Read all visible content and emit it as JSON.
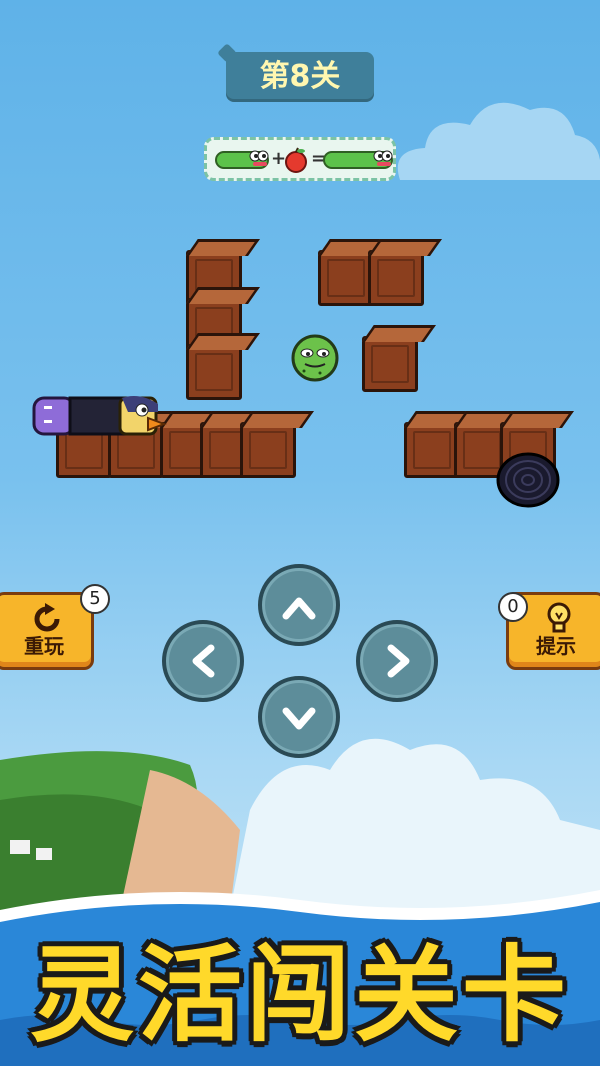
{
  "header": {
    "level_label": "第8关"
  },
  "formula": {
    "plus": "+",
    "equals": "="
  },
  "controls": {
    "restart": {
      "label": "重玩",
      "count": "5"
    },
    "hint": {
      "label": "提示",
      "count": "0"
    }
  },
  "banner": {
    "text": "灵活闯关卡"
  },
  "colors": {
    "sky": "#79c1ee",
    "crate": "#8b3f1e",
    "button_orange": "#f7b52a",
    "banner_yellow": "#ffd92a",
    "dpad": "#5d8d9a"
  },
  "icons": [
    "restart-icon",
    "lightbulb-icon",
    "arrow-up-icon",
    "arrow-down-icon",
    "arrow-left-icon",
    "arrow-right-icon"
  ]
}
